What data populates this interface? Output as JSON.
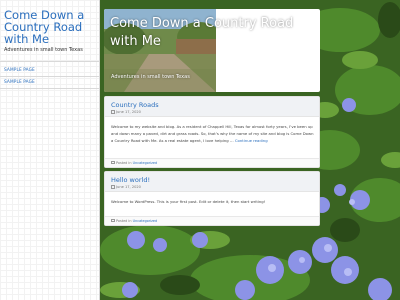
{
  "site": {
    "title": "Come Down a Country Road with Me",
    "description": "Adventures in small town Texas"
  },
  "nav": {
    "items": [
      {
        "label": "SAMPLE PAGE"
      },
      {
        "label": "SAMPLE PAGE"
      }
    ]
  },
  "header": {
    "title": "Come Down a Country Road with Me",
    "tagline": "Adventures in small town Texas"
  },
  "posts": [
    {
      "title": "Country Roads",
      "date": "June 17, 2020",
      "excerpt": "Welcome to my website and blog. As a resident of Chappell Hill, Texas for almost forty years, I’ve been up and down many a paved, dirt and grass roads. So, that’s why the name of my site and blog is Come Down a Country Road with Me. As a real estate agent, I love helping …",
      "continue": "Continue reading",
      "posted_in": "Posted in",
      "category": "Uncategorized"
    },
    {
      "title": "Hello world!",
      "date": "June 17, 2020",
      "excerpt": "Welcome to WordPress. This is your first post. Edit or delete it, then start writing!",
      "posted_in": "Posted in",
      "category": "Uncategorized"
    }
  ],
  "colors": {
    "link": "#2a6ebd",
    "foliage": "#3d6b25",
    "flower": "#8a8fe0"
  }
}
